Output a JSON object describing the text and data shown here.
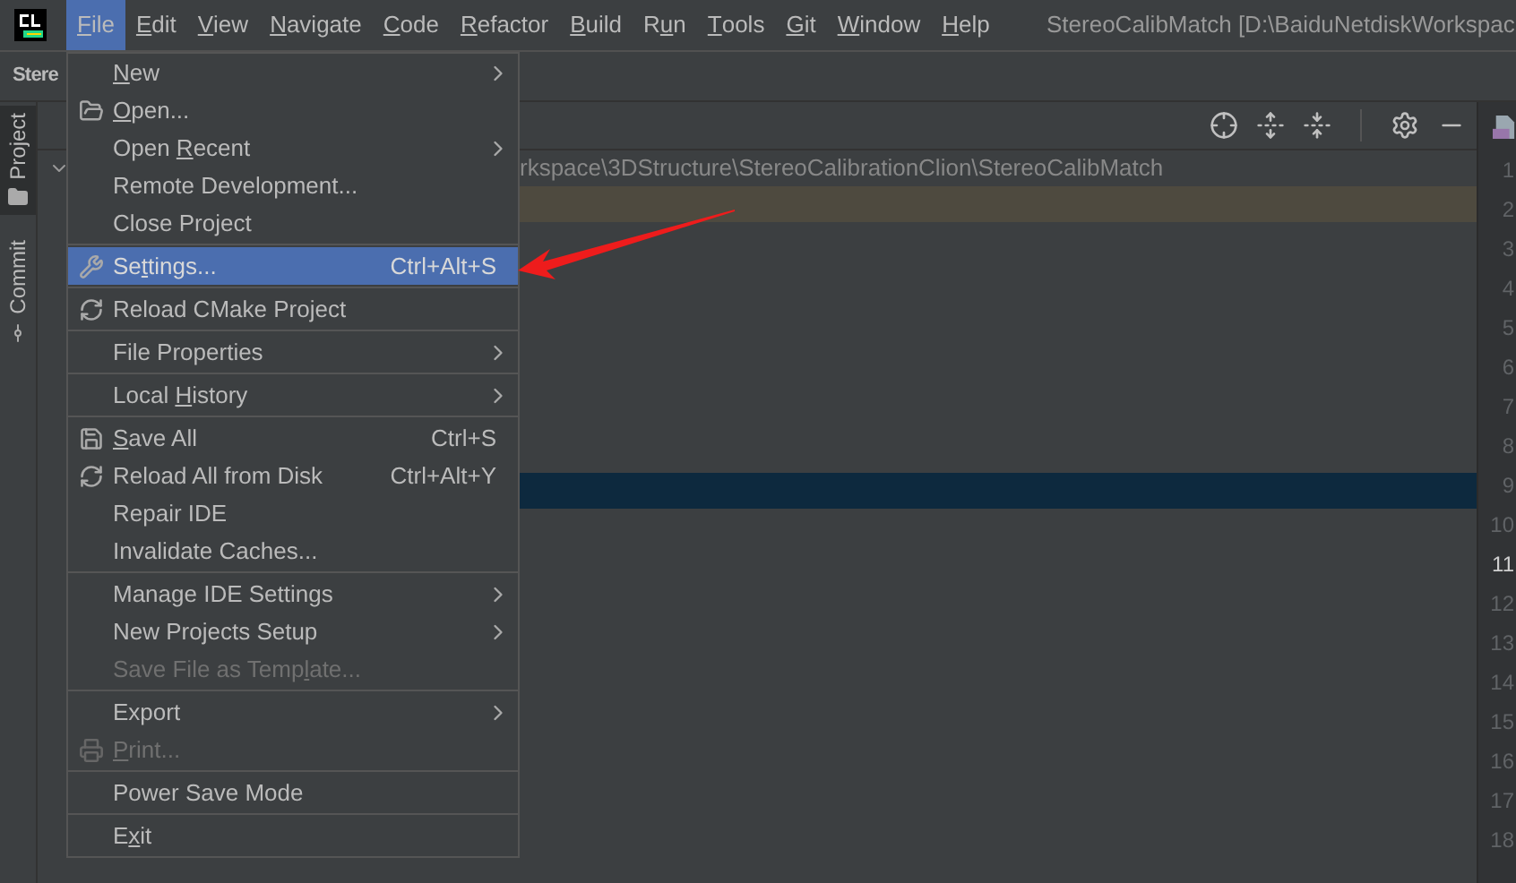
{
  "menubar": {
    "items": [
      {
        "label": {
          "key": "F",
          "post": "ile"
        },
        "selected": true
      },
      {
        "label": {
          "key": "E",
          "post": "dit"
        },
        "selected": false
      },
      {
        "label": {
          "key": "V",
          "post": "iew"
        },
        "selected": false
      },
      {
        "label": {
          "key": "N",
          "post": "avigate"
        },
        "selected": false
      },
      {
        "label": {
          "key": "C",
          "post": "ode"
        },
        "selected": false
      },
      {
        "label": {
          "key": "R",
          "post": "efactor"
        },
        "selected": false
      },
      {
        "label": {
          "key": "B",
          "post": "uild"
        },
        "selected": false
      },
      {
        "label": {
          "pre": "R",
          "key": "u",
          "post": "n"
        },
        "selected": false
      },
      {
        "label": {
          "key": "T",
          "post": "ools"
        },
        "selected": false
      },
      {
        "label": {
          "key": "G",
          "post": "it"
        },
        "selected": false
      },
      {
        "label": {
          "key": "W",
          "post": "indow"
        },
        "selected": false
      },
      {
        "label": {
          "key": "H",
          "post": "elp"
        },
        "selected": false
      }
    ],
    "title": "StereoCalibMatch [D:\\BaiduNetdiskWorkspac"
  },
  "navbar": {
    "project": "Stere"
  },
  "tool_strip": [
    {
      "label": "Project",
      "kind": "folder",
      "selected": true
    },
    {
      "label": "Commit",
      "kind": "commit",
      "selected": false
    }
  ],
  "project_panel": {
    "rows": [
      {
        "text": "rkspace\\3DStructure\\StereoCalibrationClion\\StereoCalibMatch",
        "expanded": true
      },
      {
        "highlighted": true,
        "selected": false
      },
      {
        "highlighted": false,
        "selected": true
      }
    ]
  },
  "gutter": {
    "lines": [
      {
        "number": "1",
        "current": false
      },
      {
        "number": "2",
        "current": false
      },
      {
        "number": "3",
        "current": false
      },
      {
        "number": "4",
        "current": false
      },
      {
        "number": "5",
        "current": false
      },
      {
        "number": "6",
        "current": false
      },
      {
        "number": "7",
        "current": false
      },
      {
        "number": "8",
        "current": false
      },
      {
        "number": "9",
        "current": false
      },
      {
        "number": "10",
        "current": false
      },
      {
        "number": "11",
        "current": true
      },
      {
        "number": "12",
        "current": false
      },
      {
        "number": "13",
        "current": false
      },
      {
        "number": "14",
        "current": false
      },
      {
        "number": "15",
        "current": false
      },
      {
        "number": "16",
        "current": false
      },
      {
        "number": "17",
        "current": false
      },
      {
        "number": "18",
        "current": false
      }
    ]
  },
  "file_menu": {
    "groups": [
      [
        {
          "label": {
            "key": "N",
            "post": "ew"
          },
          "kind": "plain",
          "submenu": true,
          "selected": false,
          "disabled": false
        },
        {
          "label": {
            "key": "O",
            "post": "pen..."
          },
          "kind": "folder",
          "submenu": false,
          "selected": false,
          "disabled": false
        },
        {
          "label": {
            "pre": "Open ",
            "key": "R",
            "post": "ecent"
          },
          "kind": "plain",
          "submenu": true,
          "selected": false,
          "disabled": false
        },
        {
          "label": {
            "pre": "Remote Development..."
          },
          "kind": "plain",
          "submenu": false,
          "selected": false,
          "disabled": false
        },
        {
          "label": {
            "pre": "Close Project"
          },
          "kind": "plain",
          "submenu": false,
          "selected": false,
          "disabled": false
        }
      ],
      [
        {
          "label": {
            "pre": "Se",
            "key": "t",
            "post": "tings..."
          },
          "kind": "wrench",
          "shortcut": "Ctrl+Alt+S",
          "submenu": false,
          "selected": true,
          "disabled": false
        }
      ],
      [
        {
          "label": {
            "pre": "Reload CMake Project"
          },
          "kind": "refresh",
          "submenu": false,
          "selected": false,
          "disabled": false
        }
      ],
      [
        {
          "label": {
            "pre": "File Properties"
          },
          "kind": "plain",
          "submenu": true,
          "selected": false,
          "disabled": false
        }
      ],
      [
        {
          "label": {
            "pre": "Local ",
            "key": "H",
            "post": "istory"
          },
          "kind": "plain",
          "submenu": true,
          "selected": false,
          "disabled": false
        }
      ],
      [
        {
          "label": {
            "key": "S",
            "post": "ave All"
          },
          "kind": "disk",
          "shortcut": "Ctrl+S",
          "submenu": false,
          "selected": false,
          "disabled": false
        },
        {
          "label": {
            "pre": "Reload All from Disk"
          },
          "kind": "refresh",
          "shortcut": "Ctrl+Alt+Y",
          "submenu": false,
          "selected": false,
          "disabled": false
        },
        {
          "label": {
            "pre": "Repair IDE"
          },
          "kind": "plain",
          "submenu": false,
          "selected": false,
          "disabled": false
        },
        {
          "label": {
            "pre": "Invalidate Caches..."
          },
          "kind": "plain",
          "submenu": false,
          "selected": false,
          "disabled": false
        }
      ],
      [
        {
          "label": {
            "pre": "Manage IDE Settings"
          },
          "kind": "plain",
          "submenu": true,
          "selected": false,
          "disabled": false
        },
        {
          "label": {
            "pre": "New Projects Setup"
          },
          "kind": "plain",
          "submenu": true,
          "selected": false,
          "disabled": false
        },
        {
          "label": {
            "pre": "Save File as Temp",
            "key": "l",
            "post": "ate..."
          },
          "kind": "plain",
          "submenu": false,
          "selected": false,
          "disabled": true
        }
      ],
      [
        {
          "label": {
            "pre": "Export"
          },
          "kind": "plain",
          "submenu": true,
          "selected": false,
          "disabled": false
        },
        {
          "label": {
            "key": "P",
            "post": "rint..."
          },
          "kind": "printer",
          "submenu": false,
          "selected": false,
          "disabled": true
        }
      ],
      [
        {
          "label": {
            "pre": "Power Save Mode"
          },
          "kind": "plain",
          "submenu": false,
          "selected": false,
          "disabled": false
        }
      ],
      [
        {
          "label": {
            "pre": "E",
            "key": "x",
            "post": "it"
          },
          "kind": "plain",
          "submenu": false,
          "selected": false,
          "disabled": false
        }
      ]
    ]
  }
}
